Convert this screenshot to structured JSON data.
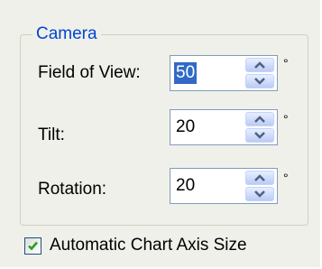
{
  "camera": {
    "title": "Camera",
    "fields": [
      {
        "label": "Field of View:",
        "value": "50",
        "unit": "°"
      },
      {
        "label": "Tilt:",
        "value": "20",
        "unit": "°"
      },
      {
        "label": "Rotation:",
        "value": "20",
        "unit": "°"
      }
    ]
  },
  "auto_axis": {
    "label": "Automatic Chart Axis Size",
    "checked": true
  },
  "icons": {
    "spin_up": "arrow-up-icon",
    "spin_down": "arrow-down-icon",
    "check": "checkmark-icon"
  },
  "colors": {
    "legend": "#0046d5",
    "selection": "#316ac5",
    "panel": "#f0f0ea",
    "check": "#21a121"
  }
}
